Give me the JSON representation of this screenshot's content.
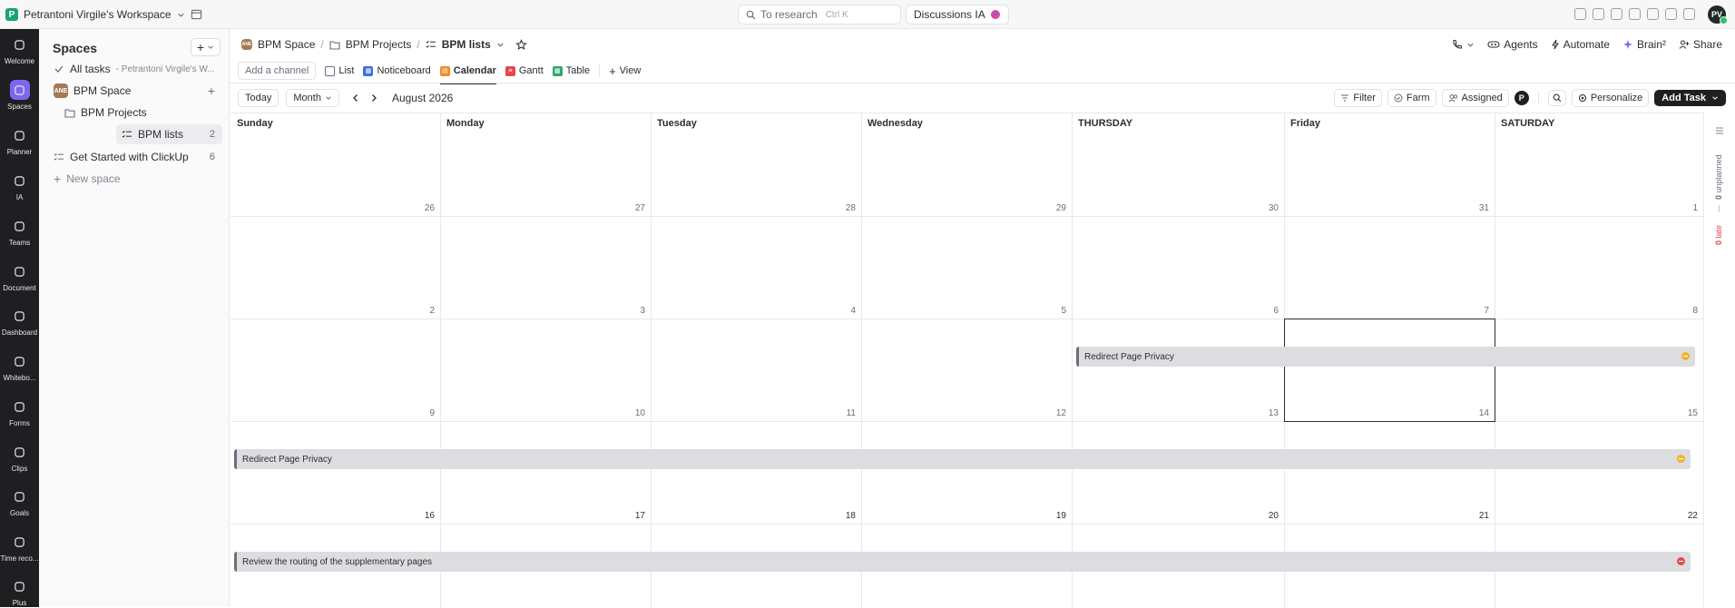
{
  "workspace": {
    "name": "Petrantoni Virgile's Workspace",
    "logo_letter": "P"
  },
  "topbar": {
    "search_placeholder": "To research",
    "search_shortcut": "Ctrl K",
    "discussions_label": "Discussions IA",
    "avatar_initials": "PV"
  },
  "rail": [
    {
      "label": "Welcome",
      "icon": "home-icon"
    },
    {
      "label": "Spaces",
      "icon": "spaces-icon"
    },
    {
      "label": "Planner",
      "icon": "planner-icon"
    },
    {
      "label": "IA",
      "icon": "ai-icon"
    },
    {
      "label": "Teams",
      "icon": "teams-icon"
    },
    {
      "label": "Document",
      "icon": "document-icon"
    },
    {
      "label": "Dashboard",
      "icon": "dashboard-icon"
    },
    {
      "label": "Whitebo...",
      "icon": "whiteboard-icon"
    },
    {
      "label": "Forms",
      "icon": "forms-icon"
    },
    {
      "label": "Clips",
      "icon": "clips-icon"
    },
    {
      "label": "Goals",
      "icon": "goals-icon"
    },
    {
      "label": "Time reco...",
      "icon": "clock-icon"
    },
    {
      "label": "Plus",
      "icon": "grid-icon"
    }
  ],
  "sidebar": {
    "title": "Spaces",
    "all_tasks_label": "All tasks",
    "all_tasks_owner": "- Petrantoni Virgile's W...",
    "space_name": "BPM Space",
    "space_badge": "ANE",
    "folder_name": "BPM Projects",
    "list_name": "BPM lists",
    "list_count": "2",
    "getting_started": "Get Started with ClickUp",
    "getting_started_count": "6",
    "new_space": "New space"
  },
  "breadcrumb": {
    "space": "BPM Space",
    "folder": "BPM Projects",
    "list": "BPM lists"
  },
  "header_actions": {
    "agents": "Agents",
    "automate": "Automate",
    "brain": "Brain²",
    "share": "Share"
  },
  "views": {
    "add_channel": "Add a channel",
    "list": "List",
    "noticeboard": "Noticeboard",
    "calendar": "Calendar",
    "gantt": "Gantt",
    "table": "Table",
    "add_view": "View"
  },
  "toolbar": {
    "today": "Today",
    "mode": "Month",
    "period": "August 2026",
    "filter": "Filter",
    "farm": "Farm",
    "assigned": "Assigned",
    "user_badge": "P",
    "personalize": "Personalize",
    "add_task": "Add Task"
  },
  "calendar": {
    "days": [
      "Sunday",
      "Monday",
      "Tuesday",
      "Wednesday",
      "THURSDAY",
      "Friday",
      "SATURDAY"
    ],
    "weeks": [
      [
        "26",
        "27",
        "28",
        "29",
        "30",
        "31",
        "1"
      ],
      [
        "2",
        "3",
        "4",
        "5",
        "6",
        "7",
        "8"
      ],
      [
        "9",
        "10",
        "11",
        "12",
        "13",
        "14",
        "15"
      ],
      [
        "16",
        "17",
        "18",
        "19",
        "20",
        "21",
        "22"
      ]
    ],
    "today": "14",
    "events": [
      {
        "title": "Redirect Page Privacy",
        "status_color": "#f0b429"
      },
      {
        "title": "Redirect Page Privacy",
        "status_color": "#f0b429"
      },
      {
        "title": "Review the routing of the supplementary pages",
        "status_color": "#e5484d"
      }
    ]
  },
  "right_panel": {
    "unplanned_count": "0",
    "unplanned_label": "unplanned",
    "late_count": "0",
    "late_label": "late"
  }
}
